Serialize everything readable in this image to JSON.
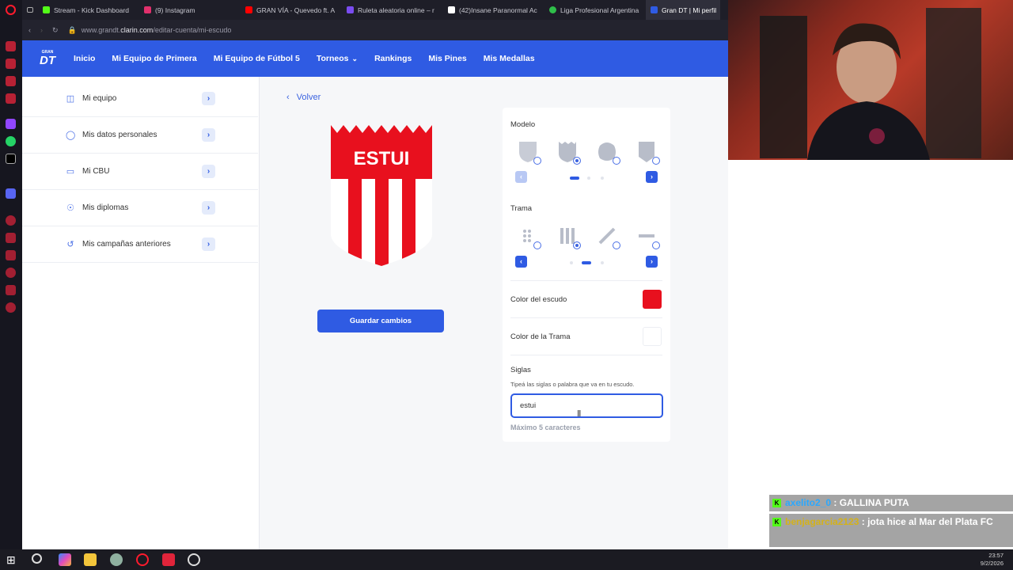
{
  "browser": {
    "tabs": [
      {
        "label": "Stream - Kick Dashboard",
        "color": "#53fc18"
      },
      {
        "label": "(9) Instagram",
        "color": "#e1306c"
      },
      {
        "label": "GRAN VÍA - Quevedo ft. A",
        "color": "#ff0000"
      },
      {
        "label": "Ruleta aleatoria online – r",
        "color": "#7a4cf0"
      },
      {
        "label": "(42)Insane Paranormal Ac",
        "color": "#ffffff"
      },
      {
        "label": "Liga Profesional Argentina",
        "color": "#2fbf4a"
      },
      {
        "label": "Gran DT | Mi perfil",
        "color": "#2f5be3"
      }
    ],
    "url_host": "www.grandt.",
    "url_bold": "clarin.com",
    "url_path": "/editar-cuenta/mi-escudo"
  },
  "nav": {
    "logo_top": "GRAN",
    "logo_main": "DT",
    "links": [
      "Inicio",
      "Mi Equipo de Primera",
      "Mi Equipo de Fútbol 5",
      "Torneos",
      "Rankings",
      "Mis Pines",
      "Mis Medallas"
    ]
  },
  "sidebar": {
    "items": [
      {
        "label": "Mi equipo",
        "icon": "shirt-icon"
      },
      {
        "label": "Mis datos personales",
        "icon": "person-icon"
      },
      {
        "label": "Mi CBU",
        "icon": "card-icon"
      },
      {
        "label": "Mis diplomas",
        "icon": "award-icon"
      },
      {
        "label": "Mis campañas anteriores",
        "icon": "history-icon"
      }
    ]
  },
  "main": {
    "back_label": "Volver",
    "crest_text": "ESTUI",
    "save_label": "Guardar cambios"
  },
  "editor": {
    "modelo_title": "Modelo",
    "trama_title": "Trama",
    "color_escudo_label": "Color del escudo",
    "color_escudo": "#e8101e",
    "color_trama_label": "Color de la Trama",
    "color_trama": "#ffffff",
    "siglas_title": "Siglas",
    "siglas_hint": "Tipeá las siglas o palabra que va en tu escudo.",
    "siglas_value": "estui",
    "siglas_max": "Máximo 5 caracteres"
  },
  "chat": [
    {
      "user": "axelito2_0",
      "text": " : GALLINA PUTA",
      "user_color": "#2aa8ff"
    },
    {
      "user": "benjagarcia2123",
      "text": " : jota hice al Mar del Plata FC",
      "user_color": "#d4b21a"
    },
    {
      "user": "benjagarcia2123",
      "text": " : ",
      "user_color": "#d4b21a"
    }
  ],
  "clock": {
    "time": "23:57",
    "date": "9/2/2026"
  }
}
